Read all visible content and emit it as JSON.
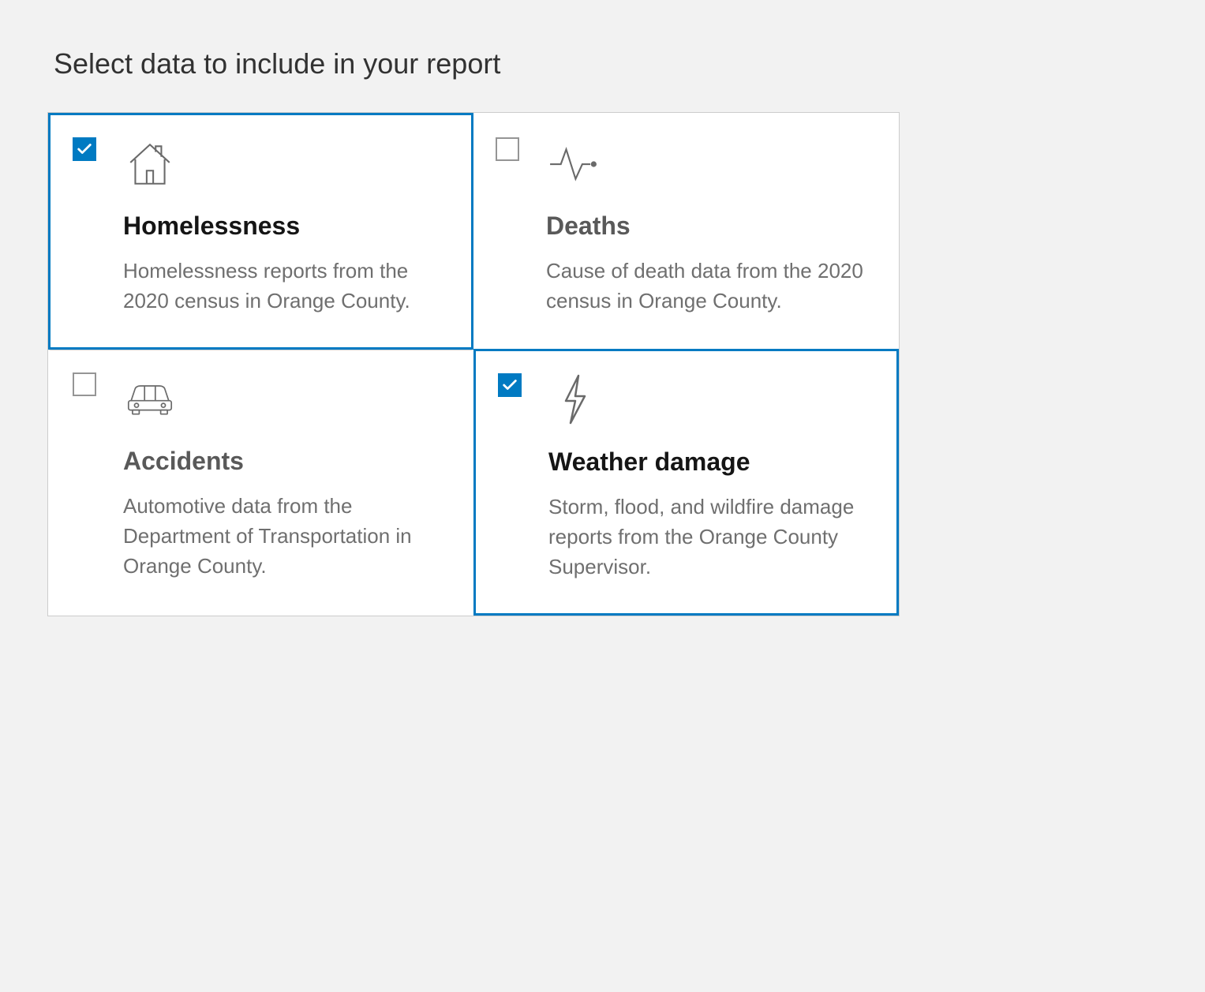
{
  "page": {
    "title": "Select data to include in your report"
  },
  "colors": {
    "accent": "#007ac2"
  },
  "cards": [
    {
      "icon": "house-icon",
      "title": "Homelessness",
      "description": "Homelessness reports from the 2020 census in Orange County.",
      "selected": true
    },
    {
      "icon": "pulse-icon",
      "title": "Deaths",
      "description": "Cause of death data from the 2020 census in Orange County.",
      "selected": false
    },
    {
      "icon": "car-icon",
      "title": "Accidents",
      "description": "Automotive data from the Department of Transportation in Orange County.",
      "selected": false
    },
    {
      "icon": "lightning-icon",
      "title": "Weather damage",
      "description": "Storm, flood, and wildfire damage reports from the Orange County Supervisor.",
      "selected": true
    }
  ]
}
